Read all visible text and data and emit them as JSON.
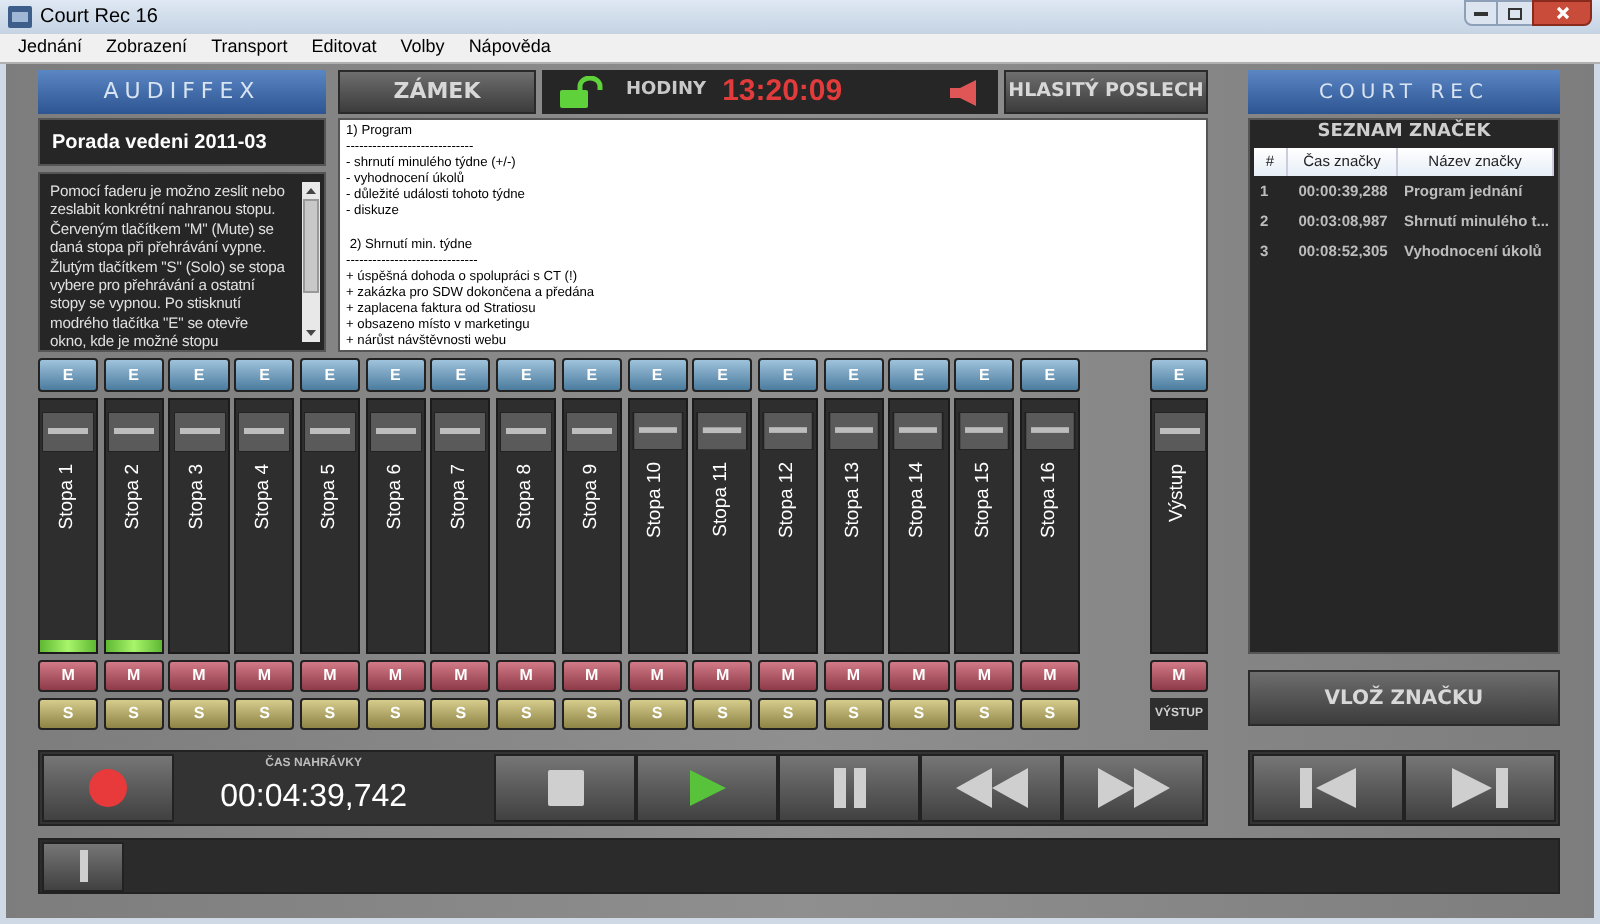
{
  "window": {
    "title": "Court Rec 16"
  },
  "menu": [
    "Jednání",
    "Zobrazení",
    "Transport",
    "Editovat",
    "Volby",
    "Nápověda"
  ],
  "header": {
    "logo": "AUDIFFEX",
    "lock_button": "ZÁMEK",
    "lock_open": true,
    "clock_label": "HODINY",
    "clock": "13:20:09",
    "listen_button": "HLASITÝ POSLECH"
  },
  "session": {
    "title": "Porada vedeni 2011-03",
    "help": "Pomocí faderu je možno zeslit nebo\nzeslabit konkrétní nahranou stopu.\nČerveným tlačítkem \"M\" (Mute) se\ndaná stopa při přehrávání vypne.\nŽlutým tlačítkem \"S\" (Solo) se stopa\nvybere pro přehrávání a ostatní\nstopy se vypnou. Po stisknutí\nmodrého tlačítka \"E\" se otevře\nokno, kde je možné stopu"
  },
  "notes": "1) Program\n-----------------------------\n- shrnutí minulého týdne (+/-)\n- vyhodnocení úkolů\n- důležité události tohoto týdne\n- diskuze\n\n 2) Shrnutí min. týdne\n------------------------------\n+ úspěšná dohoda o spolupráci s CT (!)\n+ zakázka pro SDW dokončena a předána\n+ zaplacena faktura od Stratiosu\n+ obsazeno místo v marketingu\n+ nárůst návštěvnosti webu",
  "tracks": [
    {
      "label": "Stopa 1",
      "level": 0.1,
      "edit": "E",
      "mute": "M",
      "solo": "S"
    },
    {
      "label": "Stopa 2",
      "level": 0.1,
      "edit": "E",
      "mute": "M",
      "solo": "S"
    },
    {
      "label": "Stopa 3",
      "level": 0,
      "edit": "E",
      "mute": "M",
      "solo": "S"
    },
    {
      "label": "Stopa 4",
      "level": 0,
      "edit": "E",
      "mute": "M",
      "solo": "S"
    },
    {
      "label": "Stopa 5",
      "level": 0,
      "edit": "E",
      "mute": "M",
      "solo": "S"
    },
    {
      "label": "Stopa 6",
      "level": 0,
      "edit": "E",
      "mute": "M",
      "solo": "S"
    },
    {
      "label": "Stopa 7",
      "level": 0,
      "edit": "E",
      "mute": "M",
      "solo": "S"
    },
    {
      "label": "Stopa 8",
      "level": 0,
      "edit": "E",
      "mute": "M",
      "solo": "S"
    },
    {
      "label": "Stopa 9",
      "level": 0,
      "edit": "E",
      "mute": "M",
      "solo": "S"
    },
    {
      "label": "Stopa 10",
      "level": 0,
      "edit": "E",
      "mute": "M",
      "solo": "S"
    },
    {
      "label": "Stopa 11",
      "level": 0,
      "edit": "E",
      "mute": "M",
      "solo": "S"
    },
    {
      "label": "Stopa 12",
      "level": 0,
      "edit": "E",
      "mute": "M",
      "solo": "S"
    },
    {
      "label": "Stopa 13",
      "level": 0,
      "edit": "E",
      "mute": "M",
      "solo": "S"
    },
    {
      "label": "Stopa 14",
      "level": 0,
      "edit": "E",
      "mute": "M",
      "solo": "S"
    },
    {
      "label": "Stopa 15",
      "level": 0,
      "edit": "E",
      "mute": "M",
      "solo": "S"
    },
    {
      "label": "Stopa 16",
      "level": 0,
      "edit": "E",
      "mute": "M",
      "solo": "S"
    }
  ],
  "output": {
    "label": "Výstup",
    "edit": "E",
    "mute": "M",
    "caption": "VÝSTUP"
  },
  "transport": {
    "time_label": "ČAS NAHRÁVKY",
    "time": "00:04:39,742"
  },
  "markers": {
    "logo": "COURT REC",
    "title": "SEZNAM ZNAČEK",
    "columns": [
      "#",
      "Čas značky",
      "Název značky"
    ],
    "rows": [
      [
        "1",
        "00:00:39,288",
        "Program jednání"
      ],
      [
        "2",
        "00:03:08,987",
        "Shrnutí minulého t..."
      ],
      [
        "3",
        "00:08:52,305",
        "Vyhodnocení úkolů"
      ]
    ],
    "insert_button": "VLOŽ ZNAČKU"
  }
}
